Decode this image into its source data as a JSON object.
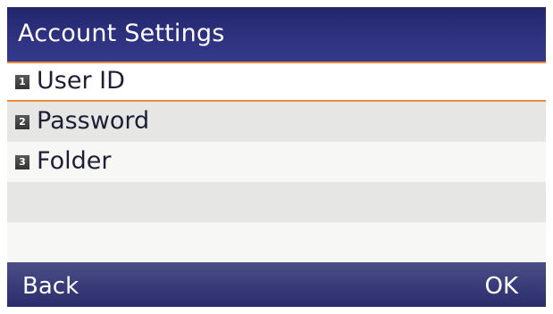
{
  "header": {
    "title": "Account Settings"
  },
  "menu": {
    "items": [
      {
        "number": "1",
        "label": "User ID",
        "selected": true
      },
      {
        "number": "2",
        "label": "Password",
        "selected": false
      },
      {
        "number": "3",
        "label": "Folder",
        "selected": false
      }
    ]
  },
  "softkeys": {
    "left": "Back",
    "right": "OK"
  },
  "colors": {
    "title_bar": "#2c307c",
    "selection_border": "#e98a3a",
    "softkey_bar": "#383b78"
  }
}
